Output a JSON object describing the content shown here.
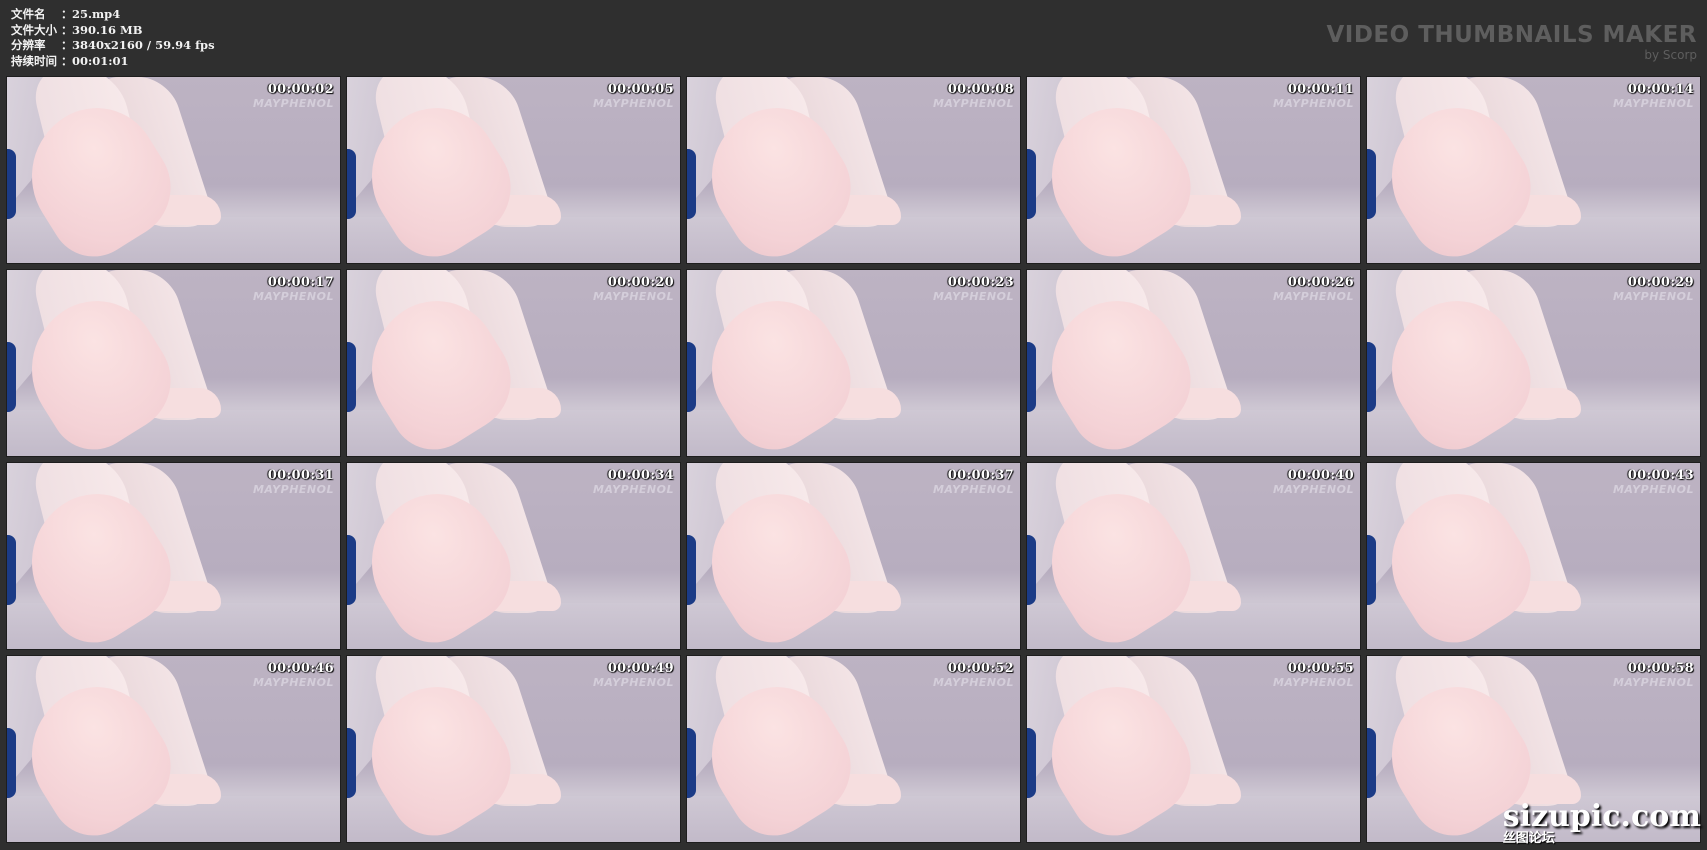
{
  "info": [
    {
      "label": "文件名",
      "sep": "：",
      "value": "25.mp4"
    },
    {
      "label": "文件大小",
      "sep": "：",
      "value": "390.16 MB"
    },
    {
      "label": "分辨率",
      "sep": "：",
      "value": "3840x2160 / 59.94 fps"
    },
    {
      "label": "持续时间",
      "sep": "：",
      "value": "00:01:01"
    }
  ],
  "brand": {
    "title": "VIDEO THUMBNAILS MAKER",
    "subtitle": "by Scorp"
  },
  "watermark": "MAYPHENOL",
  "thumbnails": [
    "00:00:02",
    "00:00:05",
    "00:00:08",
    "00:00:11",
    "00:00:14",
    "00:00:17",
    "00:00:20",
    "00:00:23",
    "00:00:26",
    "00:00:29",
    "00:00:31",
    "00:00:34",
    "00:00:37",
    "00:00:40",
    "00:00:43",
    "00:00:46",
    "00:00:49",
    "00:00:52",
    "00:00:55",
    "00:00:58"
  ],
  "site": {
    "name": "sizupic.com",
    "subtitle": "丝图论坛"
  }
}
